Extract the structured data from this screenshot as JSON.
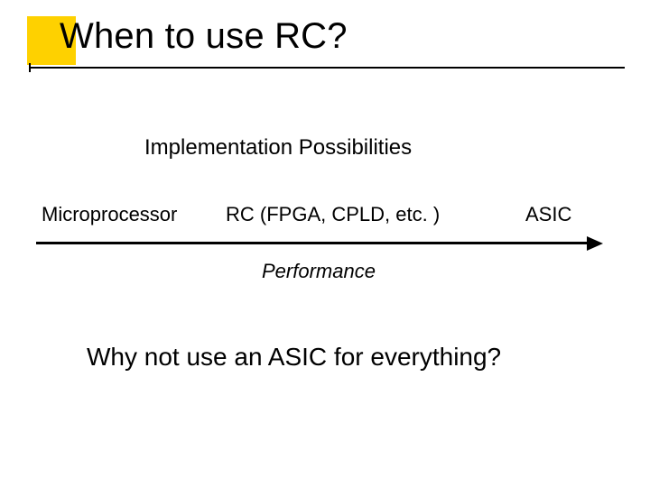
{
  "title": "When to use RC?",
  "subtitle": "Implementation Possibilities",
  "spectrum": {
    "left": "Microprocessor",
    "middle": "RC (FPGA, CPLD, etc. )",
    "right": "ASIC",
    "axis_label": "Performance"
  },
  "question": "Why not use an ASIC for everything?"
}
